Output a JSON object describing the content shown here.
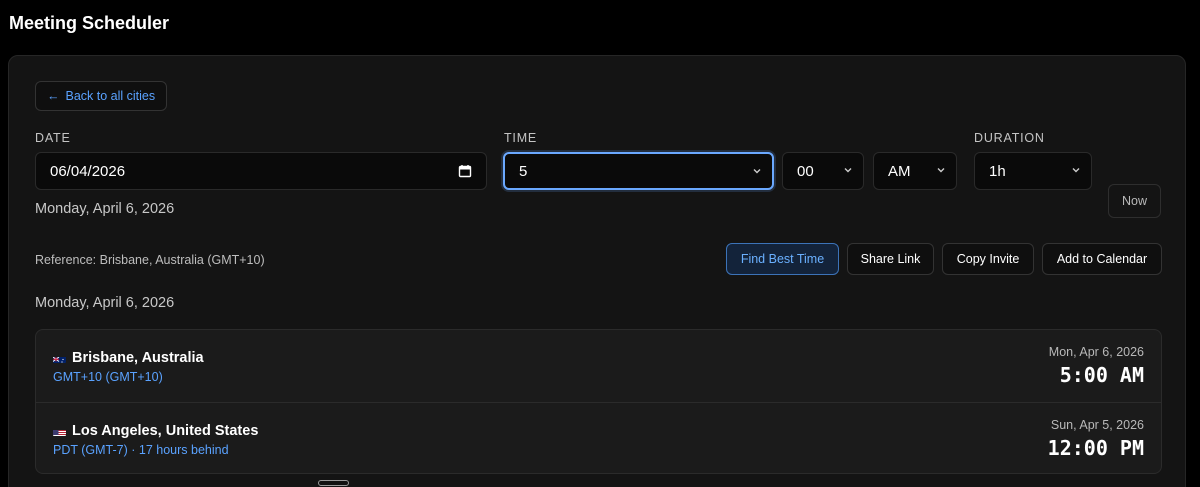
{
  "app": {
    "title": "Meeting Scheduler"
  },
  "back_button": {
    "label": "Back to all cities"
  },
  "date_field": {
    "label": "DATE",
    "value": "06/04/2026"
  },
  "time_field": {
    "label": "TIME",
    "hour": "5",
    "minute": "00",
    "meridiem": "AM"
  },
  "duration_field": {
    "label": "DURATION",
    "value": "1h"
  },
  "now_button": {
    "label": "Now"
  },
  "date_long": "Monday, April 6, 2026",
  "reference": "Reference: Brisbane, Australia (GMT+10)",
  "actions": {
    "find_best_time": "Find Best Time",
    "share_link": "Share Link",
    "copy_invite": "Copy Invite",
    "add_to_calendar": "Add to Calendar"
  },
  "date_heading": "Monday, April 6, 2026",
  "cities": [
    {
      "name": "Brisbane, Australia",
      "flag": "australia-flag-icon",
      "tz": "GMT+10 (GMT+10)",
      "date": "Mon, Apr 6, 2026",
      "time": "5:00 AM"
    },
    {
      "name": "Los Angeles, United States",
      "flag": "us-flag-icon",
      "tz": "PDT (GMT-7) · 17 hours behind",
      "date": "Sun, Apr 5, 2026",
      "time": "12:00 PM"
    }
  ],
  "colors": {
    "background": "#000000",
    "panel": "#141414",
    "accent": "#5aa2ff",
    "focus_ring": "#6aa8ff"
  }
}
